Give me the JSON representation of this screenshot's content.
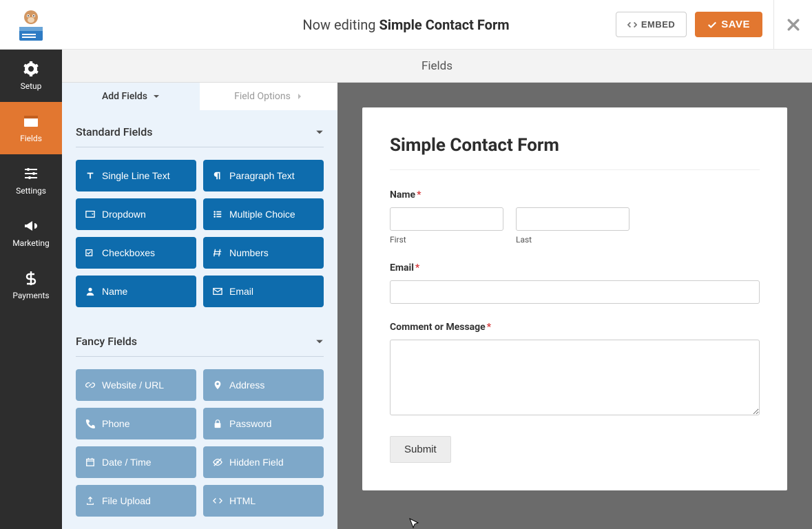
{
  "header": {
    "editing_prefix": "Now editing",
    "form_name": "Simple Contact Form",
    "embed_label": "EMBED",
    "save_label": "SAVE"
  },
  "nav": {
    "setup": "Setup",
    "fields": "Fields",
    "settings": "Settings",
    "marketing": "Marketing",
    "payments": "Payments"
  },
  "subheader": {
    "title": "Fields"
  },
  "panel": {
    "tab_add": "Add Fields",
    "tab_options": "Field Options",
    "groups": {
      "standard": {
        "title": "Standard Fields",
        "items": {
          "single_line": "Single Line Text",
          "paragraph": "Paragraph Text",
          "dropdown": "Dropdown",
          "multiple_choice": "Multiple Choice",
          "checkboxes": "Checkboxes",
          "numbers": "Numbers",
          "name": "Name",
          "email": "Email"
        }
      },
      "fancy": {
        "title": "Fancy Fields",
        "items": {
          "website": "Website / URL",
          "address": "Address",
          "phone": "Phone",
          "password": "Password",
          "datetime": "Date / Time",
          "hidden": "Hidden Field",
          "fileupload": "File Upload",
          "html": "HTML"
        }
      }
    }
  },
  "preview": {
    "form_title": "Simple Contact Form",
    "name_label": "Name",
    "first_sub": "First",
    "last_sub": "Last",
    "email_label": "Email",
    "comment_label": "Comment or Message",
    "submit_label": "Submit"
  }
}
